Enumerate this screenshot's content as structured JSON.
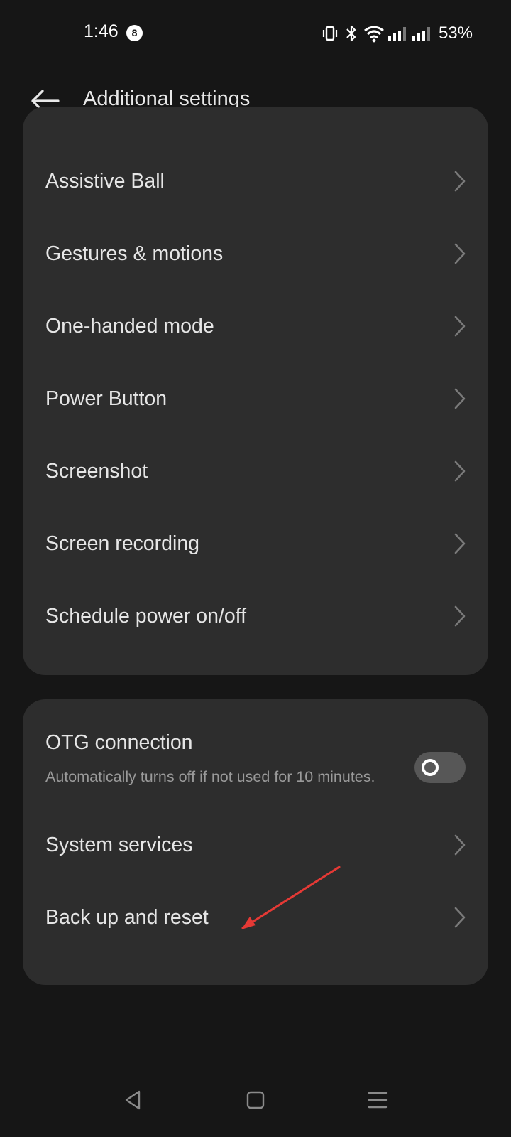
{
  "status_bar": {
    "time": "1:46",
    "notification_count": "8",
    "battery": "53%",
    "icons": [
      "vibrate-icon",
      "bluetooth-icon",
      "wifi-icon",
      "signal-icon",
      "signal-icon"
    ]
  },
  "app_bar": {
    "back_icon": "arrow-left-icon",
    "title": "Additional settings"
  },
  "group1": {
    "items": [
      {
        "label": "Assistive Ball"
      },
      {
        "label": "Gestures & motions"
      },
      {
        "label": "One-handed mode"
      },
      {
        "label": "Power Button"
      },
      {
        "label": "Screenshot"
      },
      {
        "label": "Screen recording"
      },
      {
        "label": "Schedule power on/off"
      }
    ]
  },
  "group2": {
    "otg": {
      "title": "OTG connection",
      "description": "Automatically turns off if not used for 10 minutes.",
      "enabled": false
    },
    "items": [
      {
        "label": "System services"
      },
      {
        "label": "Back up and reset"
      }
    ]
  },
  "colors": {
    "background": "#161616",
    "card": "#2d2d2d",
    "annotation": "#e53935"
  }
}
